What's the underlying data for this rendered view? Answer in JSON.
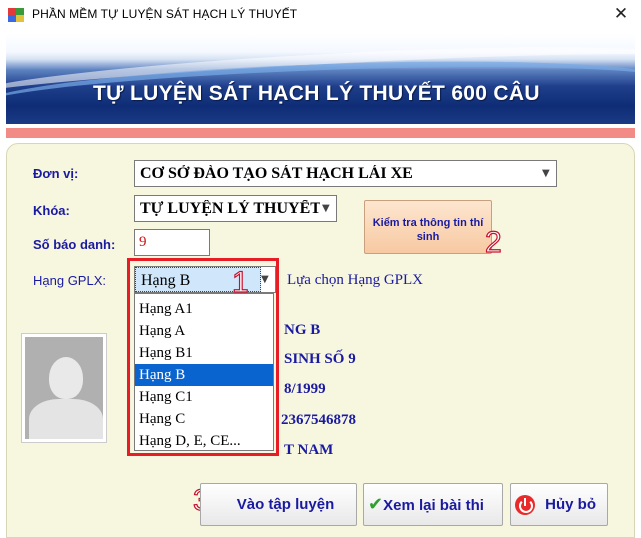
{
  "window": {
    "title": "PHẦN MỀM TỰ LUYỆN SÁT HẠCH LÝ THUYẾT",
    "close_glyph": "✕"
  },
  "banner": {
    "title": "TỰ LUYỆN SÁT HẠCH LÝ THUYẾT 600 CÂU"
  },
  "form": {
    "don_vi_label": "Đơn vị:",
    "don_vi_value": "CƠ SỞ ĐÀO TẠO SÁT HẠCH LÁI XE",
    "khoa_label": "Khóa:",
    "khoa_value": "TỰ LUYỆN LÝ THUYẾT",
    "so_bao_danh_label": "Số báo danh:",
    "so_bao_danh_value": "9",
    "hang_label": "Hạng GPLX:",
    "hang_value": "Hạng B",
    "hang_hint": "Lựa chọn Hạng GPLX",
    "check_button": "Kiểm tra thông tin thí sinh"
  },
  "dropdown": {
    "options": [
      "Hạng A1",
      "Hạng A",
      "Hạng B1",
      "Hạng B",
      "Hạng C1",
      "Hạng C",
      "Hạng D, E, CE..."
    ],
    "selected": "Hạng B"
  },
  "student_info": {
    "line1": "NG B",
    "line2": "SINH SỐ 9",
    "line3": "8/1999",
    "line4": "2367546878",
    "line5": "T NAM"
  },
  "buttons": {
    "start": "Vào tập luyện",
    "review": "Xem lại bài thi",
    "cancel": "Hủy bỏ"
  },
  "annotations": {
    "n1": "1",
    "n2": "2",
    "n3": "3"
  },
  "colors": {
    "accent_red": "#e81c24",
    "label_blue": "#1a1aa0",
    "selection_blue": "#0a64d0",
    "panel_bg": "#f7f6df",
    "pink_bar": "#f28b86"
  }
}
